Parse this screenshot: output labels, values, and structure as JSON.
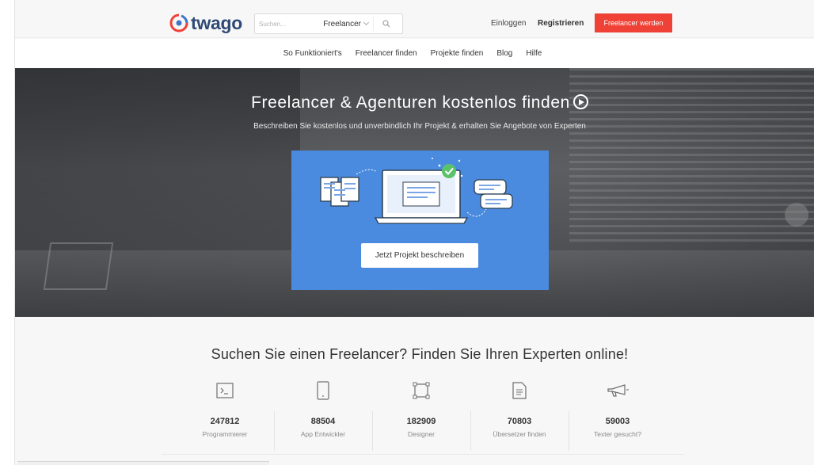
{
  "header": {
    "logo_text": "twago",
    "search": {
      "placeholder": "Suchen...",
      "selected": "Freelancer"
    },
    "login": "Einloggen",
    "register": "Registrieren",
    "cta": "Freelancer werden"
  },
  "nav": {
    "items": [
      "So Funktioniert's",
      "Freelancer finden",
      "Projekte finden",
      "Blog",
      "Hilfe"
    ]
  },
  "hero": {
    "title": "Freelancer & Agenturen kostenlos finden",
    "subtitle": "Beschreiben Sie kostenlos und unverbindlich Ihr Projekt & erhalten Sie Angebote von Experten",
    "button": "Jetzt Projekt beschreiben"
  },
  "section": {
    "heading": "Suchen Sie einen Freelancer? Finden Sie Ihren Experten online!",
    "stats": [
      {
        "value": "247812",
        "label": "Programmierer",
        "icon": "terminal-icon"
      },
      {
        "value": "88504",
        "label": "App Entwickler",
        "icon": "tablet-icon"
      },
      {
        "value": "182909",
        "label": "Designer",
        "icon": "vector-frame-icon"
      },
      {
        "value": "70803",
        "label": "Übersetzer finden",
        "icon": "document-icon"
      },
      {
        "value": "59003",
        "label": "Texter gesucht?",
        "icon": "megaphone-icon"
      }
    ]
  },
  "colors": {
    "brand": "#2f4a74",
    "accent": "#ef4136",
    "promo_blue": "#4a8be0"
  }
}
